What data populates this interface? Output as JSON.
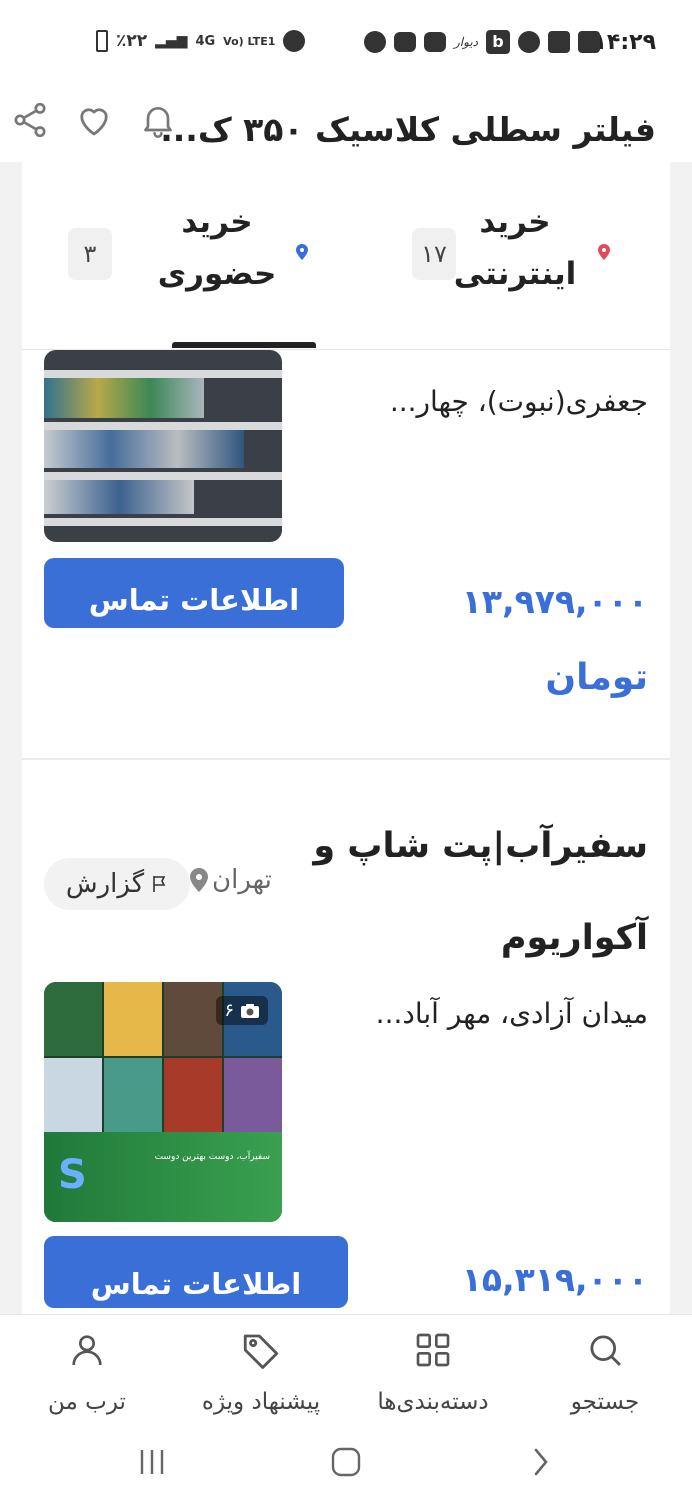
{
  "status_bar": {
    "time": "۱۴:۲۹",
    "battery": "٪۲۲",
    "network": "4G",
    "volte": "Vo) LTE1",
    "divar_label": "دیوار",
    "b_label": "b"
  },
  "header": {
    "title": "فیلتر سطلی کلاسیک ۳۵۰ ک..."
  },
  "tabs": [
    {
      "label": "خرید اینترنتی",
      "count": "۱۷",
      "dot_color": "#e24a5a"
    },
    {
      "label": "خرید حضوری",
      "count": "۳",
      "dot_color": "#3a6fd8"
    }
  ],
  "listing1": {
    "desc": "جعفری(نبوت)، چهار...",
    "contact_label": "اطلاعات تماس",
    "price": "۱۳,۹۷۹,۰۰۰",
    "currency": "تومان"
  },
  "listing2": {
    "title": "سفیرآب|پت شاپ و آکواریوم",
    "location": "تهران",
    "report_label": "گزارش",
    "desc": "میدان آزادی، مهر آباد...",
    "photo_count": "۶",
    "contact_label": "اطلاعات تماس",
    "price": "۱۵,۳۱۹,۰۰۰",
    "poster_text": "سفیرآب، دوست بهترین دوست"
  },
  "bottom_nav": [
    {
      "label": "جستجو",
      "icon": "search-icon"
    },
    {
      "label": "دسته‌بندی‌ها",
      "icon": "categories-icon"
    },
    {
      "label": "پیشنهاد ویژه",
      "icon": "tag-icon"
    },
    {
      "label": "ترب من",
      "icon": "user-icon"
    }
  ],
  "colors": {
    "accent": "#3a6fd8",
    "text": "#222222",
    "background": "#f2f2f2"
  }
}
